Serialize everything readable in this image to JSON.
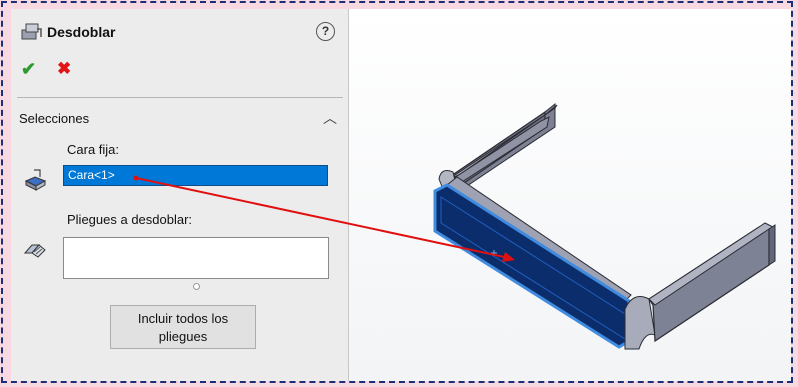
{
  "feature": {
    "title": "Desdoblar",
    "help_icon": "help-icon",
    "ok_icon": "check-icon",
    "cancel_icon": "close-icon",
    "ok_symbol": "✔",
    "cancel_symbol": "✖",
    "help_symbol": "?"
  },
  "selections": {
    "section_title": "Selecciones",
    "collapse_symbol": "︿",
    "fixed_face_label": "Cara fija:",
    "fixed_face_value": "Cara<1>",
    "bends_label": "Pliegues a desdoblar:",
    "bends_value": "",
    "include_all_button": "Incluir todos los pliegues"
  },
  "colors": {
    "ok": "#2e9a2e",
    "cancel": "#e01616",
    "selection_highlight": "#0078d7",
    "selected_face": "#0c2d6b",
    "part_gray": "#8c8fa0",
    "leader_arrow": "#e01010",
    "frame_border": "#1b2f78"
  }
}
